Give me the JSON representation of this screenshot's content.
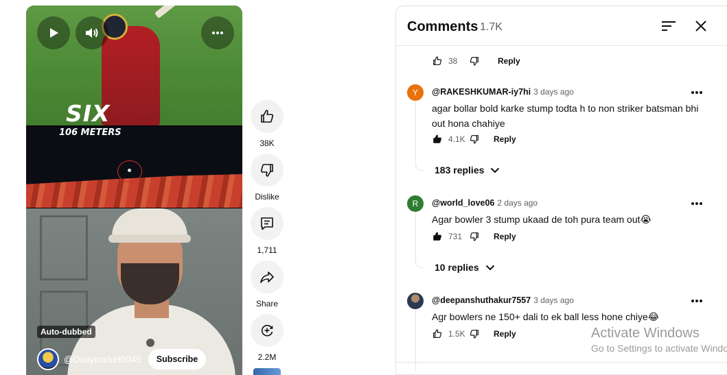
{
  "player": {
    "overlay_text_1": "SIX",
    "overlay_text_2": "106 METERS",
    "badge": "Auto-dubbed",
    "channel": "@Dailycricket0045",
    "subscribe_label": "Subscribe",
    "icons": [
      "play-icon",
      "volume-icon",
      "more-vert-icon"
    ]
  },
  "rail": {
    "like": {
      "label": "38K",
      "icon": "thumbs-up-icon"
    },
    "dislike": {
      "label": "Dislike",
      "icon": "thumbs-down-icon"
    },
    "comments": {
      "label": "1,711",
      "icon": "comment-icon"
    },
    "share": {
      "label": "Share",
      "icon": "share-icon"
    },
    "remix": {
      "label": "2.2M",
      "icon": "remix-icon"
    }
  },
  "panel": {
    "title": "Comments",
    "count": "1.7K",
    "icons": [
      "sort-icon",
      "close-icon"
    ]
  },
  "prev_comment": {
    "likes": "38",
    "reply_label": "Reply"
  },
  "comments": [
    {
      "avatar_letter": "Y",
      "avatar_color": "#e8710a",
      "author": "@RAKESHKUMAR-iy7hi",
      "time": "3 days ago",
      "text": "agar bollar bold karke stump todta h to non striker batsman bhi out hona chahiye",
      "likes": "4.1K",
      "reply_label": "Reply",
      "replies": "183 replies"
    },
    {
      "avatar_letter": "R",
      "avatar_color": "#2e7d32",
      "author": "@world_love06",
      "time": "2 days ago",
      "text": "Agar bowler 3 stump ukaad de toh pura team out😭",
      "likes": "731",
      "reply_label": "Reply",
      "replies": "10 replies"
    },
    {
      "avatar_letter": "",
      "avatar_color": "#3b4a5e",
      "author": "@deepanshuthakur7557",
      "time": "3 days ago",
      "text": "Agr bowlers ne 150+ dali to ek ball less hone chiye😂",
      "likes": "1.5K",
      "reply_label": "Reply"
    }
  ],
  "watermark": {
    "line1": "Activate Windows",
    "line2": "Go to Settings to activate Windows."
  }
}
